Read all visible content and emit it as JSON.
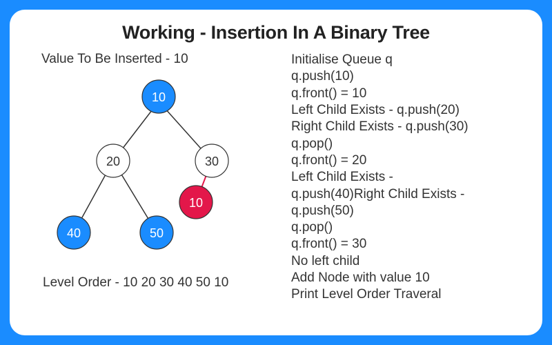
{
  "title": "Working - Insertion In A Binary Tree",
  "subheading": "Value To Be Inserted - 10",
  "level_order_label": "Level Order - 10 20 30 40 50 10",
  "tree": {
    "nodes": {
      "root": "10",
      "n20": "20",
      "n30": "30",
      "n40": "40",
      "n50": "50",
      "inserted": "10"
    },
    "colors": {
      "blue": "#1a8cff",
      "red": "#e3174a",
      "white": "#ffffff",
      "text_on_white": "#333333",
      "text_on_color": "#ffffff",
      "edge": "#333333"
    }
  },
  "steps": [
    "Initialise Queue q",
    "q.push(10)",
    "q.front() = 10",
    "Left Child Exists - q.push(20)",
    "Right Child Exists - q.push(30)",
    "q.pop()",
    "q.front() = 20",
    "Left Child Exists -",
    "q.push(40)Right Child Exists -",
    "q.push(50)",
    "q.pop()",
    "q.front() = 30",
    "No left child",
    "Add Node with value 10",
    "Print Level Order Traveral"
  ]
}
